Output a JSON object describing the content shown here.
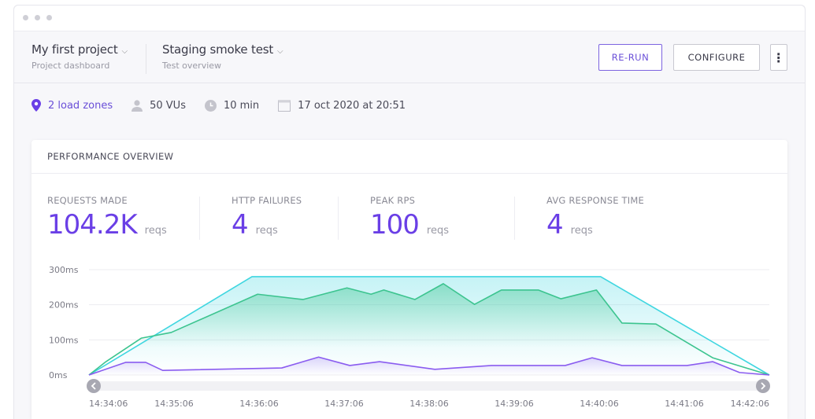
{
  "header": {
    "project": {
      "title": "My first project",
      "subtitle": "Project dashboard"
    },
    "test": {
      "title": "Staging smoke test",
      "subtitle": "Test overview"
    },
    "buttons": {
      "rerun": "RE-RUN",
      "configure": "CONFIGURE",
      "more": "⋮"
    }
  },
  "info": {
    "load_zones": "2 load zones",
    "vus": "50 VUs",
    "duration": "10 min",
    "date": "17 oct 2020 at 20:51"
  },
  "colors": {
    "accent": "#6a3fe6",
    "teal": "#3fd6e0",
    "green": "#3cc48f",
    "purple": "#8a5cf0"
  },
  "overview": {
    "title": "PERFORMANCE OVERVIEW",
    "stats": [
      {
        "label": "REQUESTS MADE",
        "value": "104.2K",
        "unit": "reqs"
      },
      {
        "label": "HTTP FAILURES",
        "value": "4",
        "unit": "reqs"
      },
      {
        "label": "PEAK RPS",
        "value": "100",
        "unit": "reqs"
      },
      {
        "label": "AVG RESPONSE TIME",
        "value": "4",
        "unit": "reqs"
      }
    ]
  },
  "chart_data": {
    "type": "area",
    "yticks": [
      "0ms",
      "100ms",
      "200ms",
      "300ms"
    ],
    "ylim": [
      0,
      300
    ],
    "xticks": [
      "14:34:06",
      "14:35:06",
      "14:36:06",
      "14:37:06",
      "14:38:06",
      "14:39:06",
      "14:40:06",
      "14:41:06",
      "14:42:06"
    ],
    "xlim": [
      "14:34:06",
      "14:42:06"
    ],
    "grid": true,
    "series": [
      {
        "color": "#3fd6e0",
        "points": [
          [
            "14:34:06",
            0
          ],
          [
            "14:36:01",
            280
          ],
          [
            "14:40:07",
            280
          ],
          [
            "14:42:06",
            0
          ]
        ]
      },
      {
        "color": "#3cc48f",
        "points": [
          [
            "14:34:06",
            0
          ],
          [
            "14:34:18",
            38
          ],
          [
            "14:34:43",
            105
          ],
          [
            "14:35:04",
            121
          ],
          [
            "14:36:05",
            230
          ],
          [
            "14:36:37",
            215
          ],
          [
            "14:37:08",
            248
          ],
          [
            "14:37:25",
            230
          ],
          [
            "14:37:34",
            242
          ],
          [
            "14:37:56",
            215
          ],
          [
            "14:38:16",
            260
          ],
          [
            "14:38:38",
            201
          ],
          [
            "14:38:57",
            242
          ],
          [
            "14:39:23",
            242
          ],
          [
            "14:39:39",
            217
          ],
          [
            "14:40:04",
            242
          ],
          [
            "14:40:22",
            148
          ],
          [
            "14:40:46",
            145
          ],
          [
            "14:41:26",
            49
          ],
          [
            "14:42:06",
            0
          ]
        ]
      },
      {
        "color": "#8a5cf0",
        "points": [
          [
            "14:34:06",
            0
          ],
          [
            "14:34:32",
            36
          ],
          [
            "14:34:46",
            36
          ],
          [
            "14:34:58",
            13
          ],
          [
            "14:36:22",
            20
          ],
          [
            "14:36:48",
            51
          ],
          [
            "14:37:10",
            27
          ],
          [
            "14:37:31",
            38
          ],
          [
            "14:38:10",
            16
          ],
          [
            "14:38:50",
            27
          ],
          [
            "14:39:42",
            27
          ],
          [
            "14:40:01",
            49
          ],
          [
            "14:40:22",
            27
          ],
          [
            "14:41:08",
            27
          ],
          [
            "14:41:26",
            38
          ],
          [
            "14:41:45",
            7
          ],
          [
            "14:42:06",
            0
          ]
        ]
      }
    ]
  }
}
